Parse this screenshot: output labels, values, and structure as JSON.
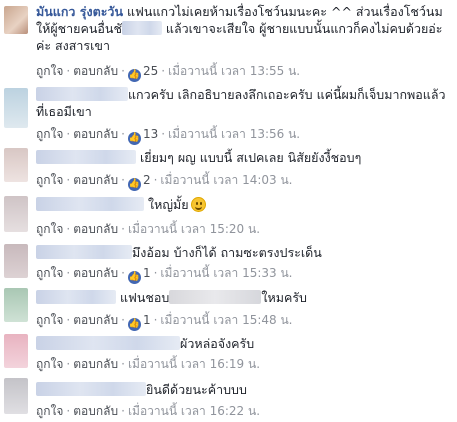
{
  "actions": {
    "like": "ถูกใจ",
    "reply": "ตอบกลับ",
    "sep": "·"
  },
  "comments": [
    {
      "author": "มันแกว รุ่งตะวัน",
      "text_a": "แฟนแกวไม่เคยห้ามเรื่องโชว์นมนะคะ ^^ ส่วนเรื่องโชว์นมให้ผู้ชายคนอื่นชั",
      "text_b": "แล้วเขาจะเสียใจ ผู้ชายแบบนั้นแกวก็คงไม่คบด้วยอ่ะค่ะ สงสารเขา",
      "likes": "25",
      "time": "เมื่อวานนี้ เวลา 13:55 น."
    },
    {
      "text": "แกวครับ เลิกอธิบายลงลึกเถอะครับ แค่นี้ผมก็เจ็บมากพอแล้วที่เธอมีเขา",
      "likes": "13",
      "time": "เมื่อวานนี้ เวลา 13:56 น."
    },
    {
      "text": "เยี่ยมๆ ผญ แบบนี้ สเปคเลย นิสัยยังงี้ชอบๆ",
      "likes": "2",
      "time": "เมื่อวานนี้ เวลา 14:03 น."
    },
    {
      "text": "ใหญ่มั้ย",
      "time": "เมื่อวานนี้ เวลา 15:20 น."
    },
    {
      "text": "มึงอ้อม บ้างก็ได้ ถามซะตรงประเด็น",
      "likes": "1",
      "time": "เมื่อวานนี้ เวลา 15:33 น."
    },
    {
      "text_a": "แฟนชอบ",
      "text_b": "ใหมครับ",
      "likes": "1",
      "time": "เมื่อวานนี้ เวลา 15:48 น."
    },
    {
      "text": "ผัวหล่อจังครับ",
      "time": "เมื่อวานนี้ เวลา 16:19 น."
    },
    {
      "text": "ยินดีด้วยนะค้าบบบ",
      "time": "เมื่อวานนี้ เวลา 16:22 น."
    }
  ],
  "colors": {
    "author": "#365899",
    "like_badge": "#4267b2",
    "meta": "#90949c"
  }
}
